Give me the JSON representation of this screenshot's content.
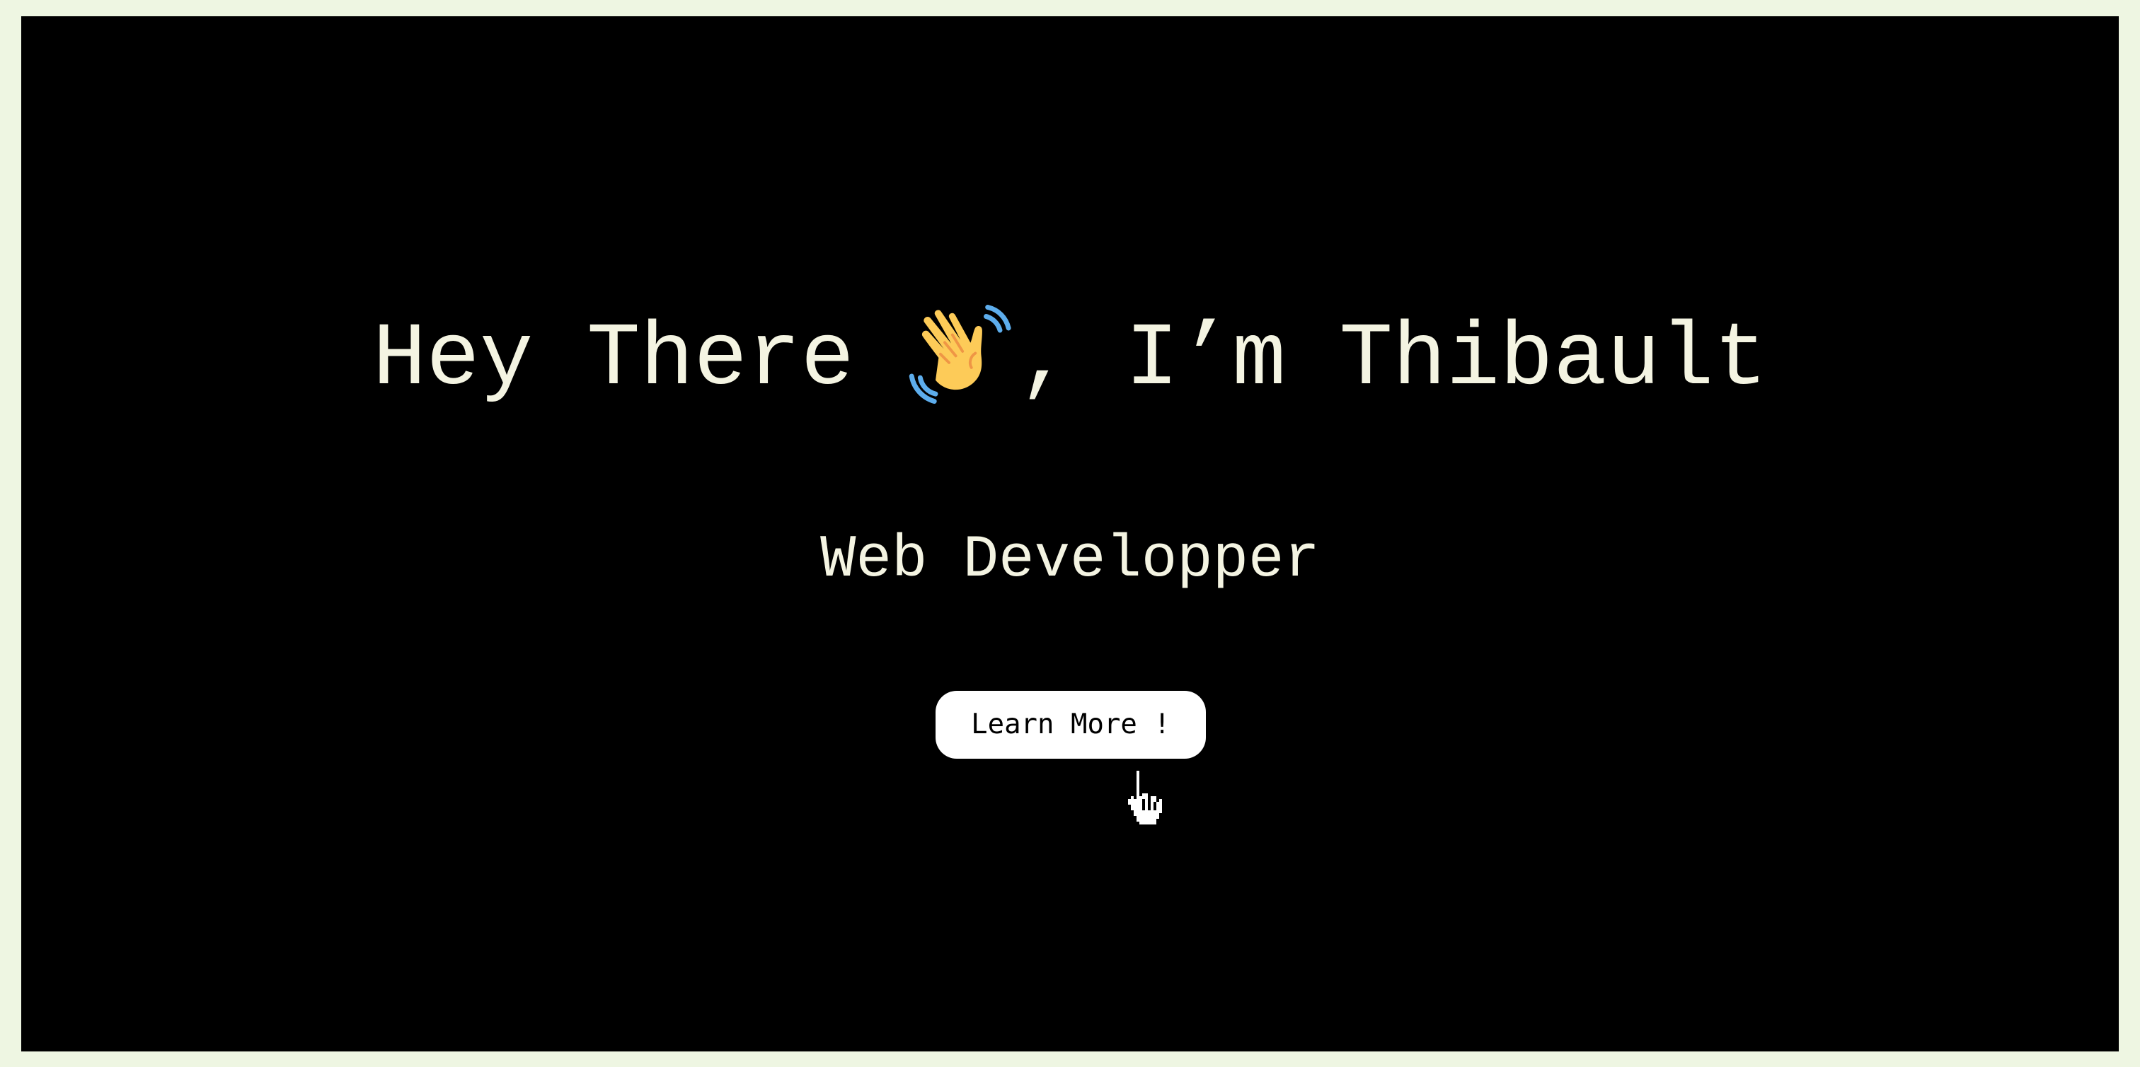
{
  "hero": {
    "greeting_before": "Hey There ",
    "wave_icon": "waving-hand-icon",
    "greeting_after": ", I’m Thibault",
    "subtitle": "Web Developper",
    "cta_label": "Learn More !"
  },
  "pointer": {
    "icon": "hand-pointer-cursor-icon"
  },
  "colors": {
    "page_border": "#eef6e2",
    "background": "#000000",
    "text": "#f4f4e2",
    "button_bg": "#ffffff",
    "button_text": "#000000",
    "wave_skin": "#fdcb58",
    "wave_motion": "#5dadec"
  }
}
